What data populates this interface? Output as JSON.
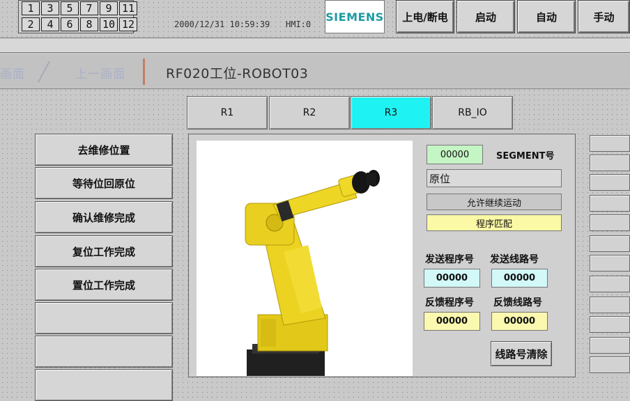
{
  "header": {
    "screen_numbers_row1": [
      "1",
      "3",
      "5",
      "7",
      "9",
      "11"
    ],
    "screen_numbers_row2": [
      "2",
      "4",
      "6",
      "8",
      "10",
      "12"
    ],
    "datetime": "2000/12/31 10:59:39",
    "hmi_label": "HMI:0",
    "brand": "SIEMENS",
    "buttons": {
      "power": "上电/断电",
      "start": "启动",
      "auto": "自动",
      "manual": "手动"
    }
  },
  "nav": {
    "prev_screen": "画面",
    "prev_screen2": "上一画面",
    "title": "RF020工位-ROBOT03"
  },
  "tabs": [
    {
      "label": "R1",
      "active": false
    },
    {
      "label": "R2",
      "active": false
    },
    {
      "label": "R3",
      "active": true
    },
    {
      "label": "RB_IO",
      "active": false
    }
  ],
  "left_menu": {
    "items": [
      "去维修位置",
      "等待位回原位",
      "确认维修完成",
      "复位工作完成",
      "置位工作完成",
      "",
      ""
    ]
  },
  "robot_panel": {
    "segment_value": "00000",
    "segment_label": "SEGMENT号",
    "position_text": "原位",
    "status_allow": "允许继续运动",
    "status_program": "程序匹配",
    "send_program_label": "发送程序号",
    "send_route_label": "发送线路号",
    "send_program_value": "00000",
    "send_route_value": "00000",
    "feedback_program_label": "反馈程序号",
    "feedback_route_label": "反馈线路号",
    "feedback_program_value": "00000",
    "feedback_route_value": "00000",
    "clear_button": "线路号清除"
  },
  "colors": {
    "active_tab": "#1ef2f2",
    "segment_field": "#c4f5c4",
    "send_field": "#d2f8f8",
    "feedback_field": "#fbf8b0",
    "program_match": "#fbf8a6",
    "siemens_brand": "#1d9ba4",
    "robot_yellow": "#e8d020"
  },
  "icons": {
    "robot_image": "industrial-robot-arm"
  }
}
